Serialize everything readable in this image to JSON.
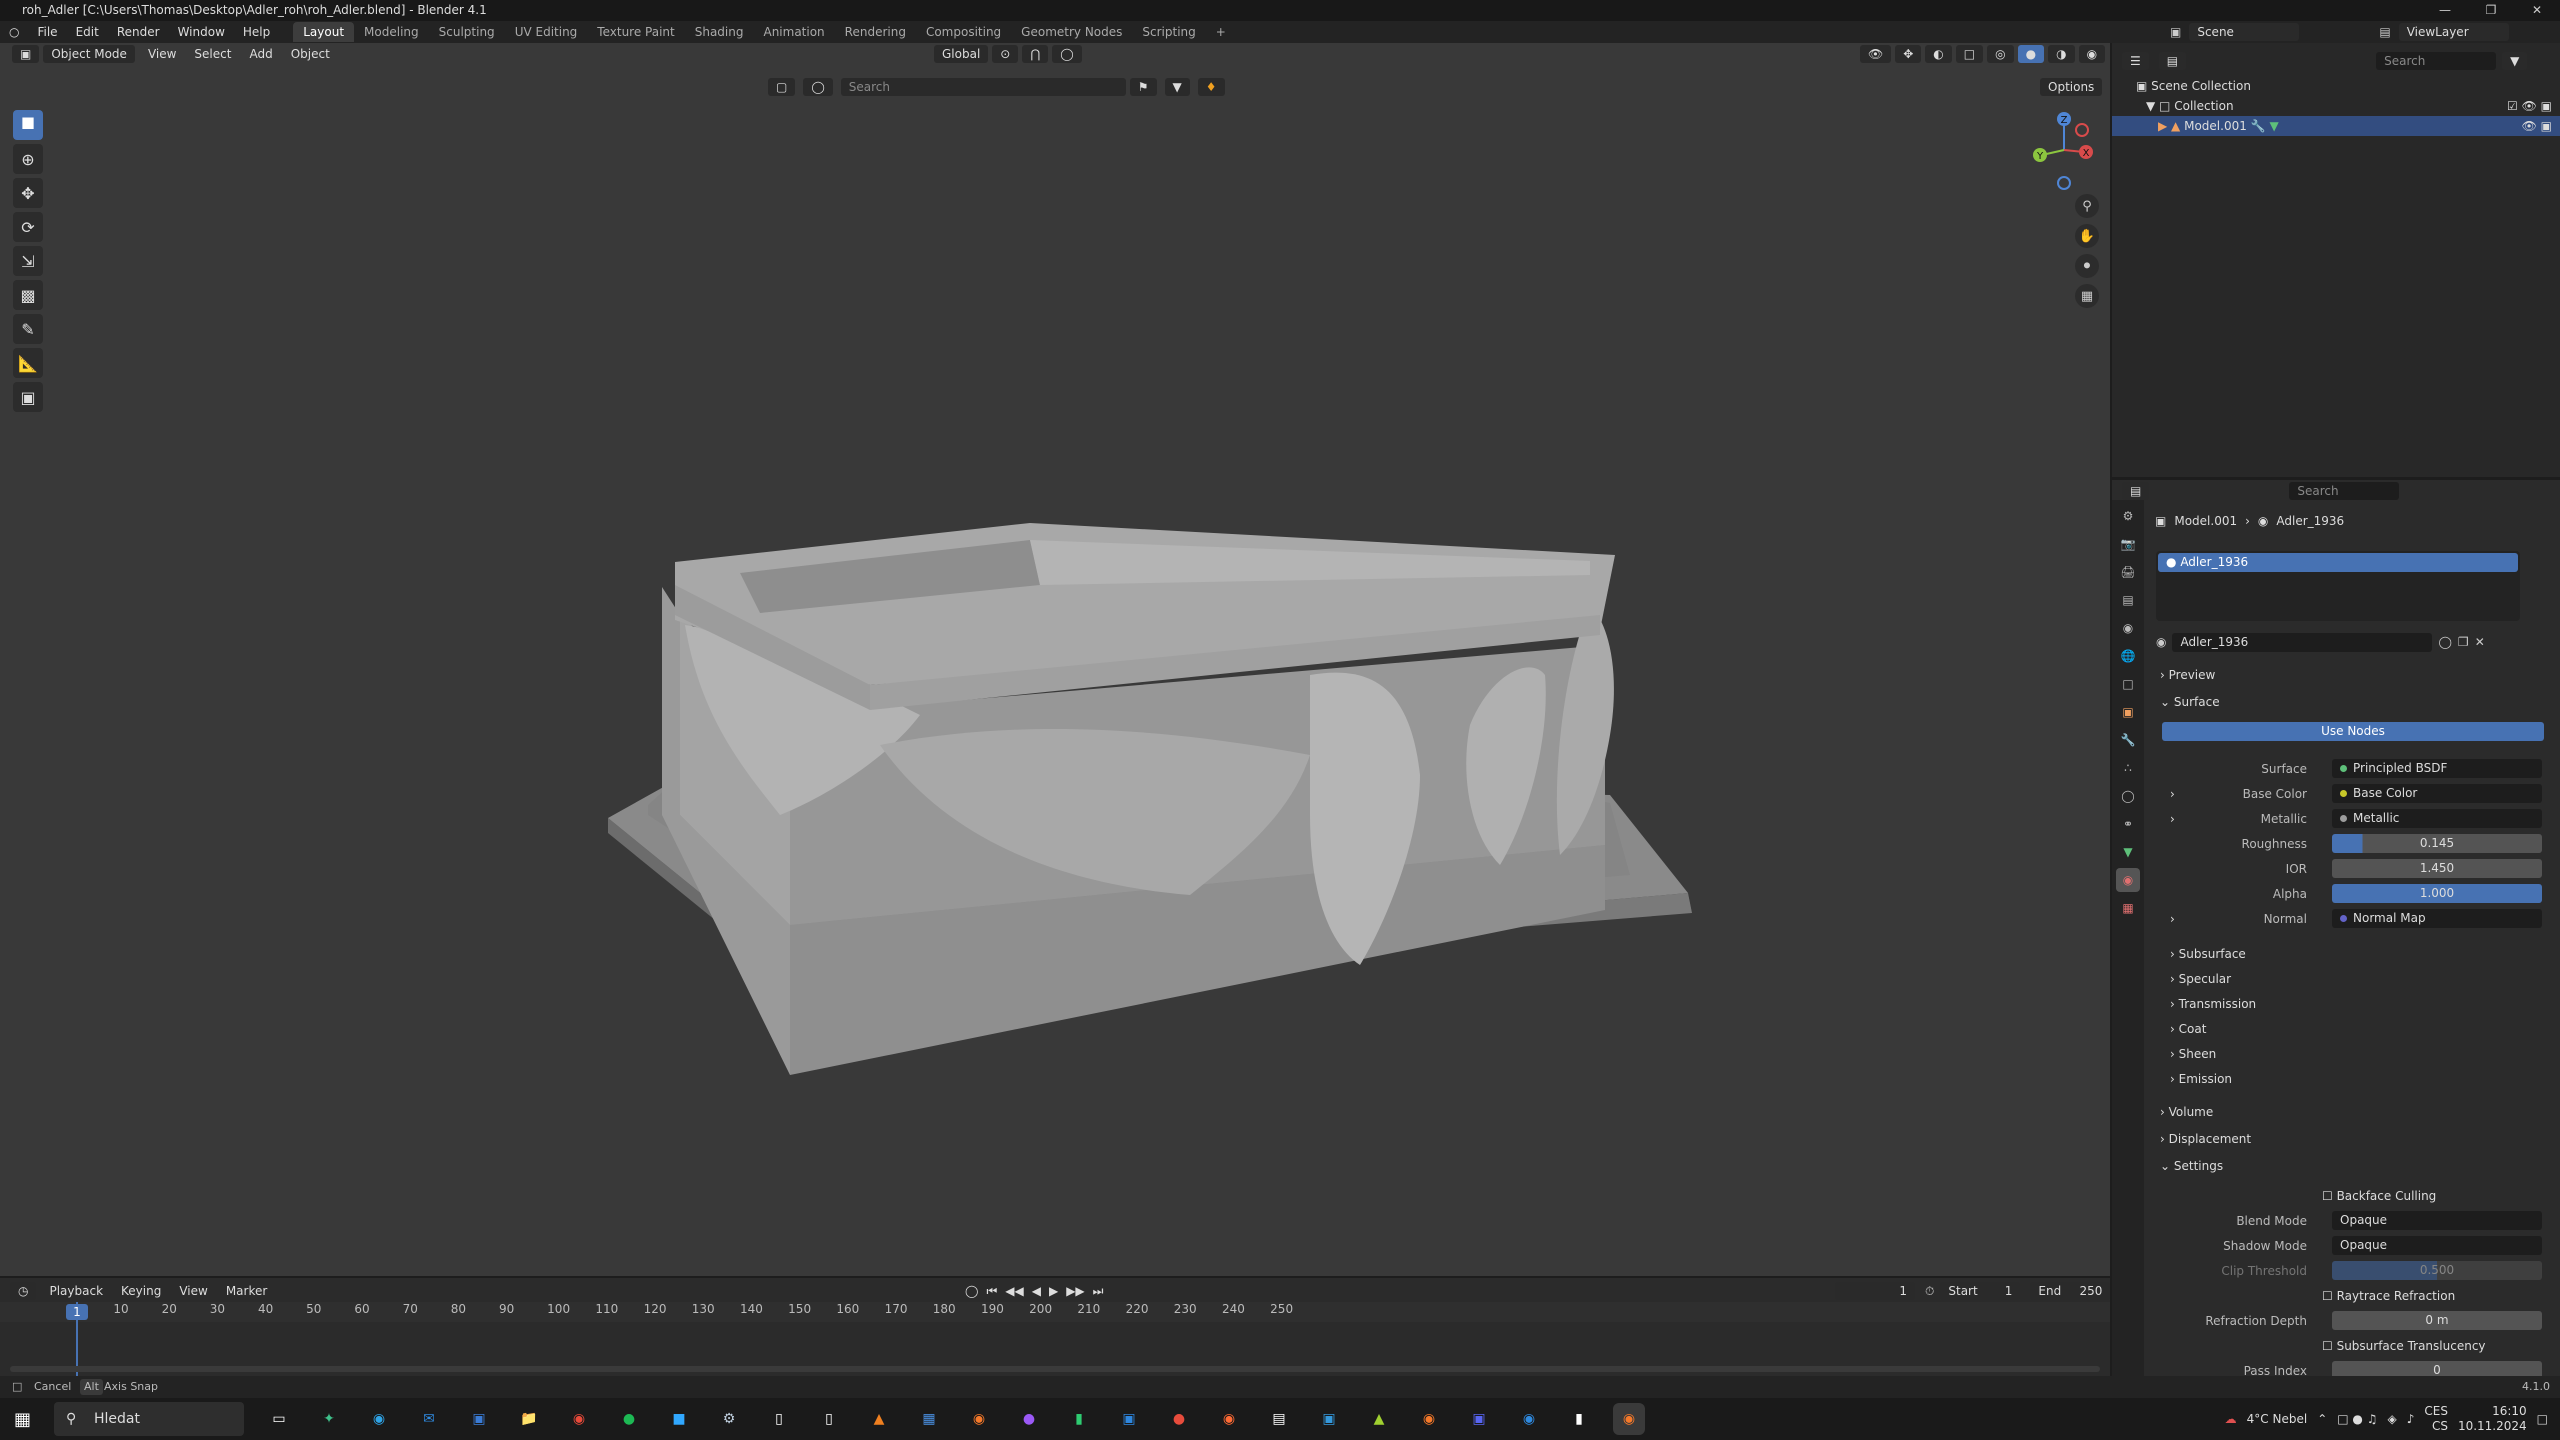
{
  "window": {
    "title": "roh_Adler [C:\\Users\\Thomas\\Desktop\\Adler_roh\\roh_Adler.blend] - Blender 4.1"
  },
  "menu": [
    "File",
    "Edit",
    "Render",
    "Window",
    "Help"
  ],
  "workspaces": [
    "Layout",
    "Modeling",
    "Sculpting",
    "UV Editing",
    "Texture Paint",
    "Shading",
    "Animation",
    "Rendering",
    "Compositing",
    "Geometry Nodes",
    "Scripting"
  ],
  "active_workspace": "Layout",
  "scene": {
    "name": "Scene",
    "view_layer": "ViewLayer"
  },
  "viewport": {
    "mode": "Object Mode",
    "menus": [
      "View",
      "Select",
      "Add",
      "Object"
    ],
    "orientation": "Global",
    "options": "Options",
    "search_placeholder": "Search",
    "gizmo_axes": [
      "Z",
      "Y",
      "X"
    ]
  },
  "outliner": {
    "search_placeholder": "Search",
    "root": "Scene Collection",
    "collection": "Collection",
    "object": "Model.001"
  },
  "properties": {
    "search_placeholder": "Search",
    "breadcrumb_object": "Model.001",
    "breadcrumb_material": "Adler_1936",
    "slot": "Adler_1936",
    "material_name": "Adler_1936",
    "panels": {
      "preview": "Preview",
      "surface": "Surface",
      "volume": "Volume",
      "displacement": "Displacement",
      "settings": "Settings"
    },
    "use_nodes": "Use Nodes",
    "fields": [
      {
        "label": "Surface",
        "value": "Principled BSDF",
        "kind": "link"
      },
      {
        "label": "Base Color",
        "value": "Base Color",
        "kind": "link"
      },
      {
        "label": "Metallic",
        "value": "Metallic",
        "kind": "link"
      },
      {
        "label": "Roughness",
        "value": "0.145",
        "kind": "num"
      },
      {
        "label": "IOR",
        "value": "1.450",
        "kind": "num"
      },
      {
        "label": "Alpha",
        "value": "1.000",
        "kind": "num"
      },
      {
        "label": "Normal",
        "value": "Normal Map",
        "kind": "link"
      }
    ],
    "subpanels": [
      "Subsurface",
      "Specular",
      "Transmission",
      "Coat",
      "Sheen",
      "Emission"
    ],
    "settings": {
      "backface_culling": "Backface Culling",
      "blend_mode_label": "Blend Mode",
      "blend_mode": "Opaque",
      "shadow_mode_label": "Shadow Mode",
      "shadow_mode": "Opaque",
      "clip_threshold_label": "Clip Threshold",
      "clip_threshold": "0.500",
      "raytrace_refraction": "Raytrace Refraction",
      "refraction_depth_label": "Refraction Depth",
      "refraction_depth": "0 m",
      "subsurface_translucency": "Subsurface Translucency",
      "pass_index_label": "Pass Index",
      "pass_index": "0"
    }
  },
  "timeline": {
    "menus": [
      "Playback",
      "Keying",
      "View",
      "Marker"
    ],
    "current_frame": "1",
    "start_label": "Start",
    "start": "1",
    "end_label": "End",
    "end": "250",
    "ruler_marks": [
      "1",
      "10",
      "20",
      "30",
      "40",
      "50",
      "60",
      "70",
      "80",
      "90",
      "100",
      "110",
      "120",
      "130",
      "140",
      "150",
      "160",
      "170",
      "180",
      "190",
      "200",
      "210",
      "220",
      "230",
      "240",
      "250"
    ]
  },
  "status": {
    "cancel": "Cancel",
    "alt": "Alt",
    "axis_snap": "Axis Snap",
    "version": "4.1.0"
  },
  "taskbar": {
    "search": "Hledat",
    "weather": "4°C  Nebel",
    "lang1": "CES",
    "lang2": "CS",
    "time": "16:10",
    "date": "10.11.2024"
  }
}
